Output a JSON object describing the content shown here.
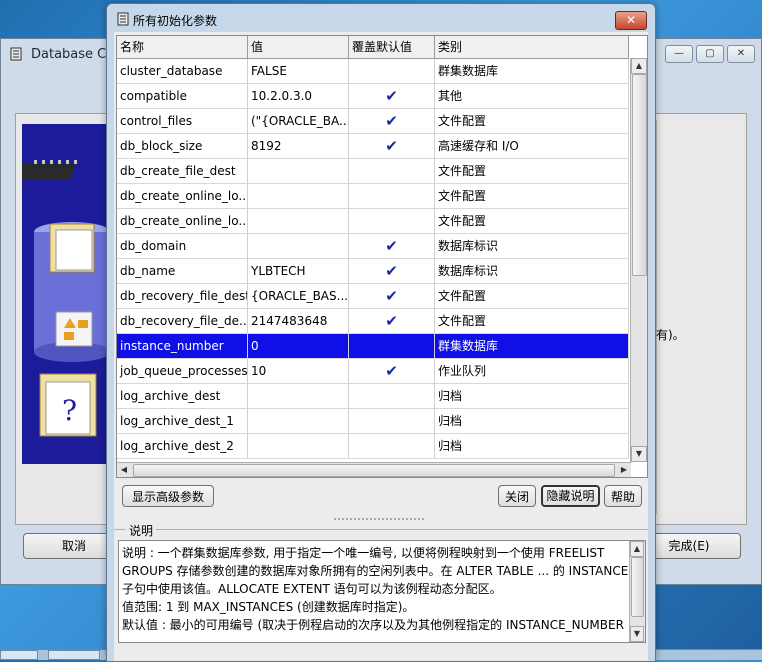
{
  "background_window": {
    "title": "Database Co",
    "side_text": "有)。",
    "cancel_label": "取消",
    "finish_label": "完成(E)",
    "controls": [
      "—",
      "▢",
      "✕"
    ]
  },
  "dialog": {
    "title": "所有初始化参数",
    "close_label": "✕"
  },
  "table": {
    "columns": [
      "名称",
      "值",
      "覆盖默认值",
      "类别"
    ],
    "rows": [
      {
        "name": "cluster_database",
        "value": "FALSE",
        "override": false,
        "category": "群集数据库"
      },
      {
        "name": "compatible",
        "value": "10.2.0.3.0",
        "override": true,
        "category": "其他"
      },
      {
        "name": "control_files",
        "value": "(\"{ORACLE_BA...",
        "override": true,
        "category": "文件配置"
      },
      {
        "name": "db_block_size",
        "value": "8192",
        "override": true,
        "category": "高速缓存和 I/O"
      },
      {
        "name": "db_create_file_dest",
        "value": "",
        "override": false,
        "category": "文件配置"
      },
      {
        "name": "db_create_online_lo...",
        "value": "",
        "override": false,
        "category": "文件配置"
      },
      {
        "name": "db_create_online_lo...",
        "value": "",
        "override": false,
        "category": "文件配置"
      },
      {
        "name": "db_domain",
        "value": "",
        "override": true,
        "category": "数据库标识"
      },
      {
        "name": "db_name",
        "value": "YLBTECH",
        "override": true,
        "category": "数据库标识"
      },
      {
        "name": "db_recovery_file_dest",
        "value": "{ORACLE_BAS...",
        "override": true,
        "category": "文件配置"
      },
      {
        "name": "db_recovery_file_de...",
        "value": "2147483648",
        "override": true,
        "category": "文件配置"
      },
      {
        "name": "instance_number",
        "value": "0",
        "override": false,
        "category": "群集数据库",
        "selected": true
      },
      {
        "name": "job_queue_processes",
        "value": "10",
        "override": true,
        "category": "作业队列"
      },
      {
        "name": "log_archive_dest",
        "value": "",
        "override": false,
        "category": "归档"
      },
      {
        "name": "log_archive_dest_1",
        "value": "",
        "override": false,
        "category": "归档"
      },
      {
        "name": "log_archive_dest_2",
        "value": "",
        "override": false,
        "category": "归档"
      }
    ],
    "check_glyph": "✔"
  },
  "buttons": {
    "advanced": "显示高级参数",
    "close": "关闭",
    "hide_desc": "隐藏说明",
    "help": "帮助"
  },
  "description": {
    "label": "说明",
    "lines": [
      "说明  : 一个群集数据库参数, 用于指定一个唯一编号, 以便将例程映射到一个使用 FREELIST",
      "GROUPS 存储参数创建的数据库对象所拥有的空闲列表中。在 ALTER TABLE ... 的 INSTANCE",
      "子句中使用该值。ALLOCATE EXTENT 语句可以为该例程动态分配区。",
      "值范围: 1 到 MAX_INSTANCES (创建数据库时指定)。",
      "默认值 : 最小的可用编号 (取决于例程启动的次序以及为其他例程指定的 INSTANCE_NUMBER"
    ]
  }
}
